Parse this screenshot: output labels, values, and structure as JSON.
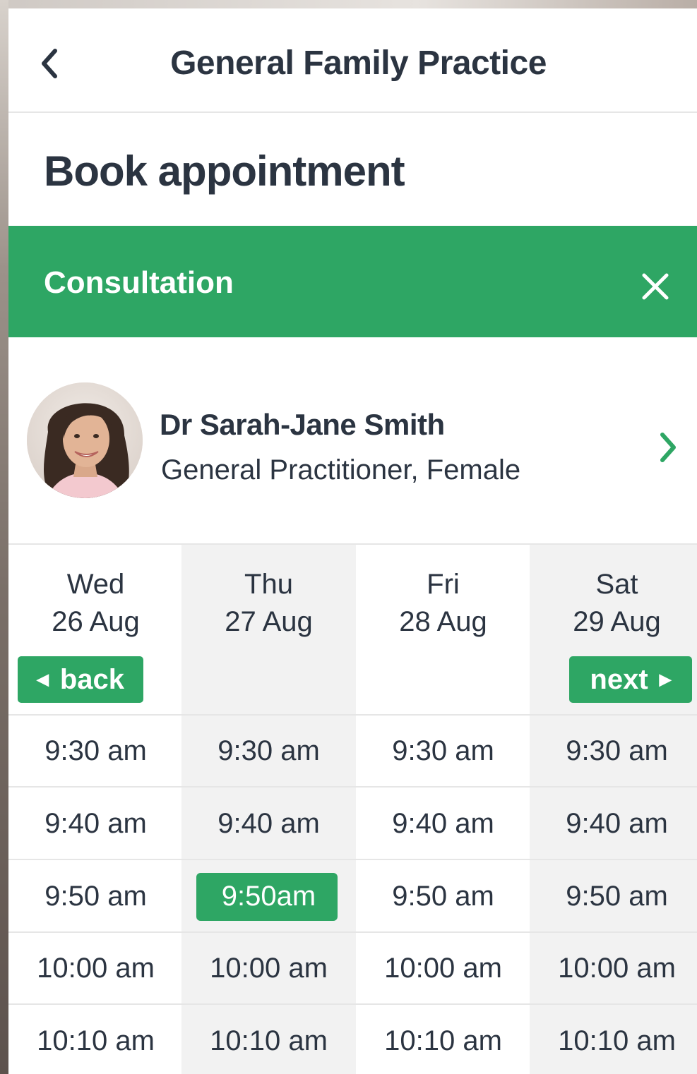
{
  "header": {
    "title": "General Family Practice",
    "back_icon": "chevron-left-icon"
  },
  "page": {
    "title": "Book appointment"
  },
  "appointment_type": {
    "label": "Consultation",
    "close_icon": "close-icon"
  },
  "doctor": {
    "name": "Dr Sarah-Jane Smith",
    "role": "General Practitioner, Female",
    "chevron_icon": "chevron-right-icon"
  },
  "calendar": {
    "back_label": "back",
    "next_label": "next",
    "days": [
      {
        "weekday": "Wed",
        "date": "26 Aug",
        "slots": [
          "9:30 am",
          "9:40 am",
          "9:50 am",
          "10:00 am",
          "10:10 am"
        ]
      },
      {
        "weekday": "Thu",
        "date": "27 Aug",
        "slots": [
          "9:30 am",
          "9:40 am",
          "9:50am",
          "10:00 am",
          "10:10 am"
        ]
      },
      {
        "weekday": "Fri",
        "date": "28 Aug",
        "slots": [
          "9:30 am",
          "9:40 am",
          "9:50 am",
          "10:00 am",
          "10:10 am"
        ]
      },
      {
        "weekday": "Sat",
        "date": "29 Aug",
        "slots": [
          "9:30 am",
          "9:40 am",
          "9:50 am",
          "10:00 am",
          "10:10 am"
        ]
      }
    ],
    "selected": {
      "day": "Thu",
      "slot": "9:50am"
    }
  },
  "colors": {
    "accent": "#2ea664",
    "text": "#2b3441",
    "shaded_column": "#f2f2f2"
  }
}
